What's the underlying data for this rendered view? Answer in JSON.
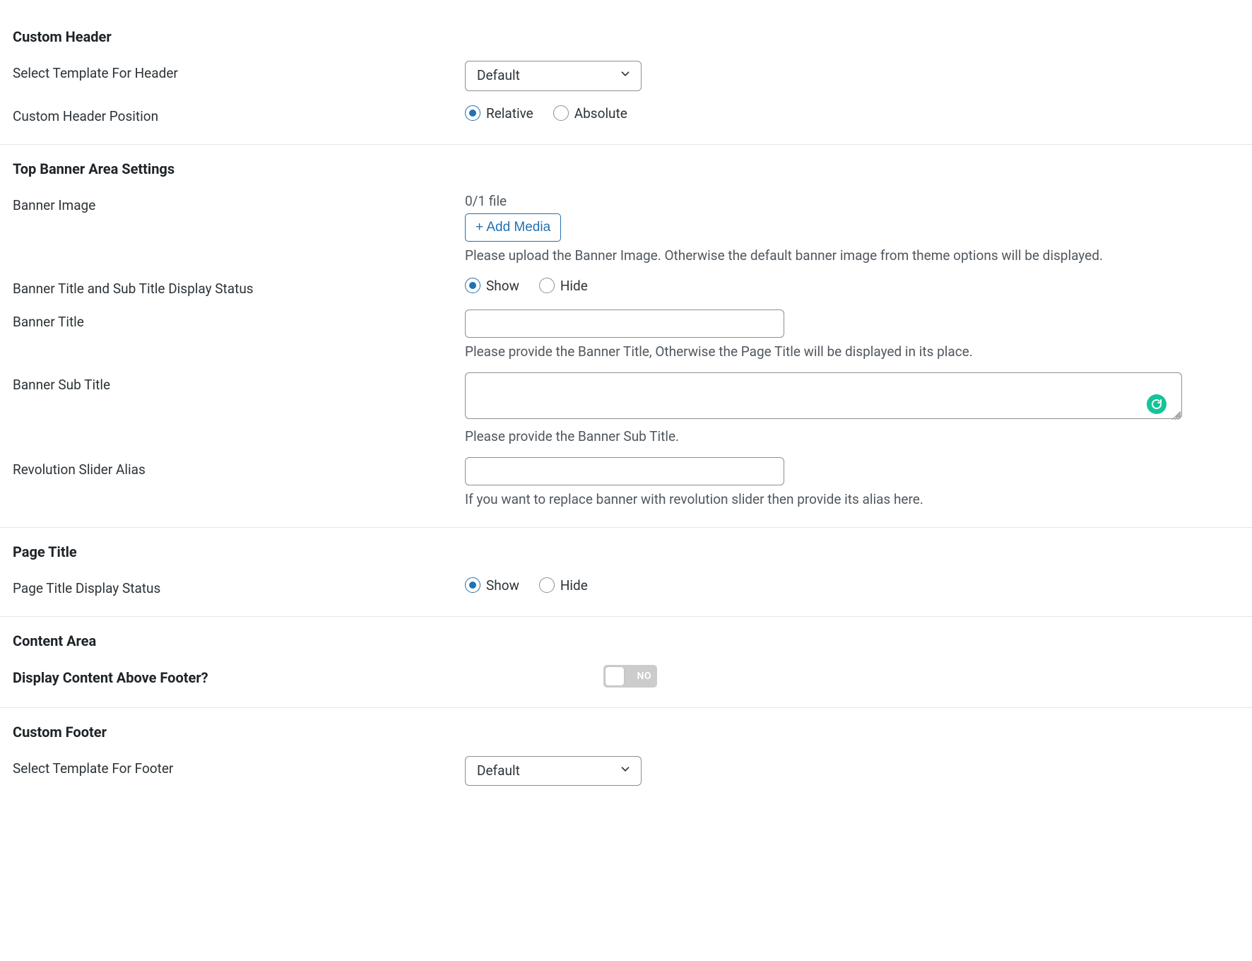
{
  "customHeader": {
    "title": "Custom Header",
    "templateLabel": "Select Template For Header",
    "templateValue": "Default",
    "positionLabel": "Custom Header Position",
    "positionOptions": {
      "relative": "Relative",
      "absolute": "Absolute"
    },
    "positionSelected": "relative"
  },
  "topBanner": {
    "title": "Top Banner Area Settings",
    "bannerImage": {
      "label": "Banner Image",
      "fileCount": "0/1 file",
      "addMedia": "+ Add Media",
      "help": "Please upload the Banner Image. Otherwise the default banner image from theme options will be displayed."
    },
    "displayStatus": {
      "label": "Banner Title and Sub Title Display Status",
      "options": {
        "show": "Show",
        "hide": "Hide"
      },
      "selected": "show"
    },
    "bannerTitle": {
      "label": "Banner Title",
      "value": "",
      "help": "Please provide the Banner Title, Otherwise the Page Title will be displayed in its place."
    },
    "bannerSubTitle": {
      "label": "Banner Sub Title",
      "value": "",
      "help": "Please provide the Banner Sub Title."
    },
    "revSlider": {
      "label": "Revolution Slider Alias",
      "value": "",
      "help": "If you want to replace banner with revolution slider then provide its alias here."
    }
  },
  "pageTitle": {
    "title": "Page Title",
    "displayStatus": {
      "label": "Page Title Display Status",
      "options": {
        "show": "Show",
        "hide": "Hide"
      },
      "selected": "show"
    }
  },
  "contentArea": {
    "title": "Content Area",
    "displayAboveFooter": {
      "label": "Display Content Above Footer?",
      "state": "NO",
      "on": false
    }
  },
  "customFooter": {
    "title": "Custom Footer",
    "templateLabel": "Select Template For Footer",
    "templateValue": "Default"
  }
}
